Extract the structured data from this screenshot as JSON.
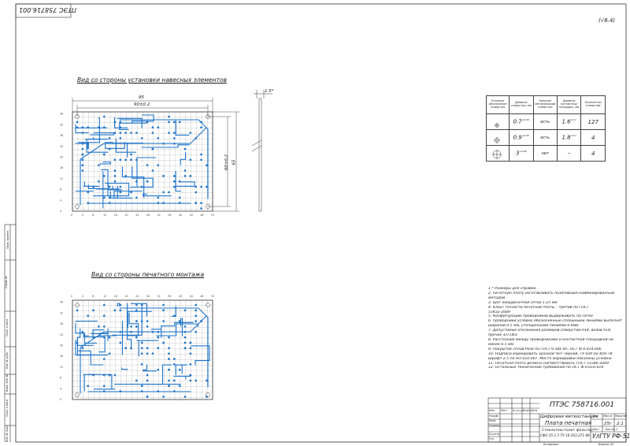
{
  "sheet": {
    "rotated_code": "ПТЭС 758716.001",
    "corner_mark": "(√6.4)"
  },
  "views": {
    "component_side": "Вид со стороны установки навесных элементов",
    "print_side": "Вид со стороны печатного монтажа"
  },
  "dimensions": {
    "width_total": "95",
    "width_inner": "90±0.2",
    "height_total": "65",
    "height_inner": "60±0.2",
    "thickness": "1.5*"
  },
  "hole_table": {
    "headers": [
      "Условное обозначение отверстия",
      "Диаметр отверстия, мм",
      "Наличие металлизации отверстия",
      "Диаметр контактных площадок, мм",
      "Количество отверстий"
    ],
    "rows": [
      {
        "symbol": "small-hole-icon",
        "diameter": "0.7",
        "diam_tol": "+0.05",
        "metal": "есть",
        "pad": "1.6",
        "pad_tol": "+0.1",
        "count": "127"
      },
      {
        "symbol": "medium-hole-icon",
        "diameter": "0.9",
        "diam_tol": "+0.05",
        "metal": "есть",
        "pad": "1.8",
        "pad_tol": "+0.1",
        "count": "4"
      },
      {
        "symbol": "mount-hole-icon",
        "diameter": "3",
        "diam_tol": "+0.05",
        "metal": "нет",
        "pad": "–",
        "pad_tol": "",
        "count": "4"
      }
    ]
  },
  "notes": [
    "1.* Размеры для справок.",
    "2. Печатную плату изготавливать позитивным комбинированным",
    "методом",
    "3. Шаг координатной сетки 1.25 мм",
    "4. Класс точности печатной платы – третий по ГОСТ",
    "53432-2009",
    "5. Конфигурацию проводников выдерживать по сетке",
    "6. Проводники условно обозначенные сплошными линиями выполнять",
    "шириной 0.5 мм, утолщенными линиями 0.8мм",
    "7. Допустимые отклонения размеров отверстий Н14, валов h14,",
    "прочих ±IT14/2",
    "8. Расстояние между проводниками и контактной площадкой не",
    "менее 0.5 мм",
    "9. Покрытие сплав Розе по ГОСТ 9.306-85, ОСТ 4Г0.014.000",
    "10. Надписи маркировать краской ЧНТ черной, ТУ 029-02-859-78",
    "Шрифт 2.5 по НО.010.007. Места маркировки показаны условно",
    "11. Печатная плата должна соответствовать ГОСТ 53386-2009",
    "12. Остальные технические требования по ОСТ 4Г0.010.014"
  ],
  "title_block": {
    "doc_code": "ПТЭС 758716.001",
    "device": "Цифровая метеостанция",
    "part": "Плата печатная",
    "material": "Стеклотекстолит фольгир.",
    "material_spec": "СФ2-35-1.5 ТУ 16-503.271-86",
    "org": "УлГТУ РФ-51",
    "col_lit": "Лит.",
    "col_mass": "Масса",
    "col_scale": "Масштаб",
    "mass": "25г",
    "scale": "2:1",
    "sheet_label": "Лист",
    "sheets_label": "Листов 1",
    "rows": [
      "Изм.",
      "Лист",
      "№ докум.",
      "Подп.",
      "Дата"
    ],
    "roles": [
      "Разраб.",
      "Пров.",
      "Т.контр.",
      "",
      "Н.контр.",
      "Утв."
    ],
    "copied": "Копировал",
    "format": "Формат  А3"
  },
  "side_stamp": {
    "labels": [
      "Перв. примен.",
      "Справ. №",
      "Подп. и дата",
      "Инв. № дубл.",
      "Взам. инв. №",
      "Подп. и дата",
      "Инв. № подл."
    ]
  },
  "colors": {
    "trace": "#1c73c9",
    "line": "#333333",
    "grid": "#7a7a7a"
  }
}
